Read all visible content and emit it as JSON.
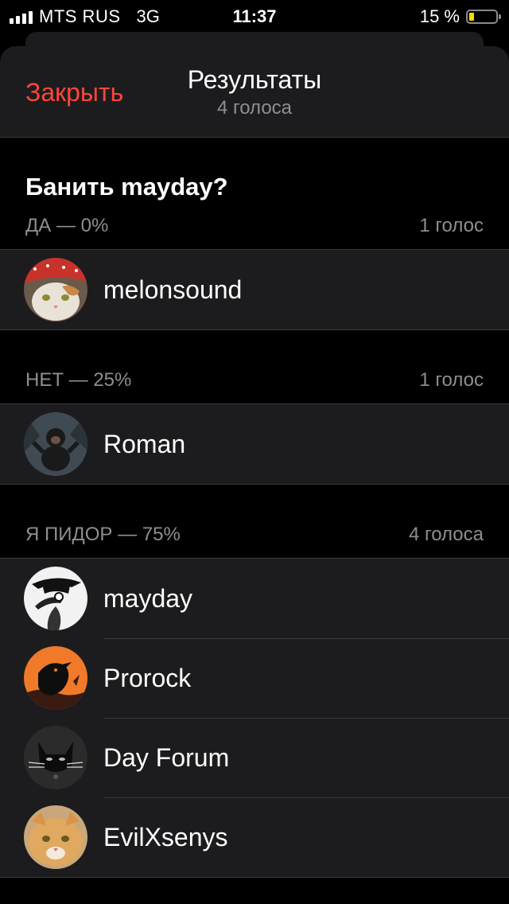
{
  "status_bar": {
    "carrier": "MTS RUS",
    "network": "3G",
    "time": "11:37",
    "battery": "15 %",
    "battery_level": 0.15,
    "battery_color": "#ffd60a"
  },
  "nav": {
    "close_label": "Закрыть",
    "title": "Результаты",
    "subtitle": "4 голоса"
  },
  "poll": {
    "question": "Банить mayday?",
    "options": [
      {
        "label": "ДА — 0%",
        "count": "1 голос",
        "voters": [
          {
            "name": "melonsound",
            "avatar": "cat-avatar-red-bandana"
          }
        ]
      },
      {
        "label": "НЕТ — 25%",
        "count": "1 голос",
        "voters": [
          {
            "name": "Roman",
            "avatar": "monkey-avatar"
          }
        ]
      },
      {
        "label": "Я ПИДОР — 75%",
        "count": "4 голоса",
        "voters": [
          {
            "name": "mayday",
            "avatar": "plague-doctor-avatar"
          },
          {
            "name": "Prorock",
            "avatar": "raven-avatar"
          },
          {
            "name": "Day Forum",
            "avatar": "black-cat-avatar"
          },
          {
            "name": "EvilXsenys",
            "avatar": "ginger-cat-avatar"
          }
        ]
      }
    ]
  },
  "colors": {
    "accent_red": "#ff453a",
    "secondary_text": "#8e8e93",
    "cell_background": "#1c1c1e"
  }
}
